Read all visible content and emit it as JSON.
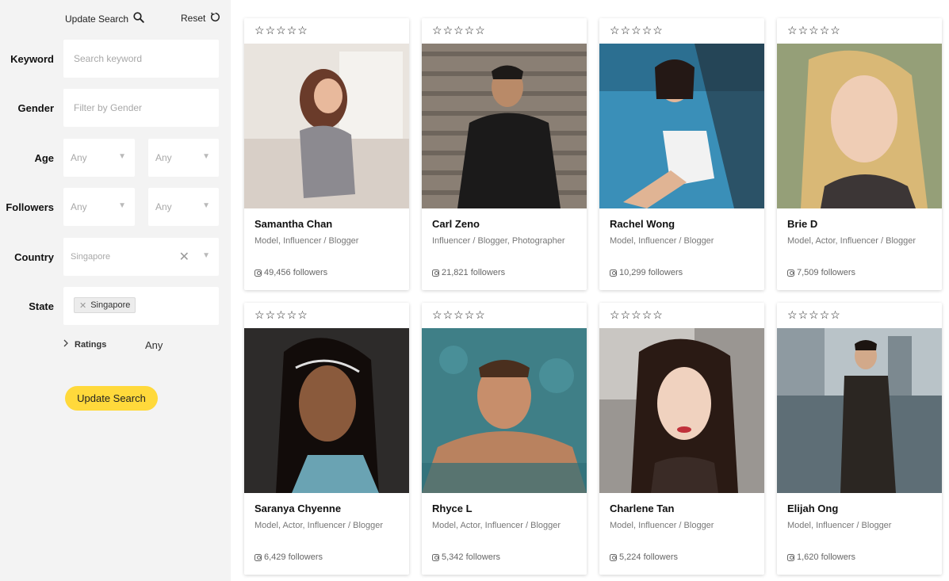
{
  "sidebar": {
    "update_search_link": "Update Search",
    "reset_link": "Reset",
    "filters": {
      "keyword": {
        "label": "Keyword",
        "placeholder": "Search keyword"
      },
      "gender": {
        "label": "Gender",
        "placeholder": "Filter by Gender"
      },
      "age": {
        "label": "Age",
        "min": "Any",
        "max": "Any"
      },
      "followers": {
        "label": "Followers",
        "min": "Any",
        "max": "Any"
      },
      "country": {
        "label": "Country",
        "value": "Singapore"
      },
      "state": {
        "label": "State",
        "tag": "Singapore"
      },
      "ratings": {
        "label": "Ratings",
        "value": "Any"
      }
    },
    "update_button": "Update Search"
  },
  "profiles": [
    {
      "name": "Samantha Chan",
      "categories": "Model, Influencer / Blogger",
      "followers": "49,456 followers"
    },
    {
      "name": "Carl Zeno",
      "categories": "Influencer / Blogger, Photographer",
      "followers": "21,821 followers"
    },
    {
      "name": "Rachel Wong",
      "categories": "Model, Influencer / Blogger",
      "followers": "10,299 followers"
    },
    {
      "name": "Brie D",
      "categories": "Model, Actor, Influencer / Blogger",
      "followers": "7,509 followers"
    },
    {
      "name": "Saranya Chyenne",
      "categories": "Model, Actor, Influencer / Blogger",
      "followers": "6,429 followers"
    },
    {
      "name": "Rhyce L",
      "categories": "Model, Actor, Influencer / Blogger",
      "followers": "5,342 followers"
    },
    {
      "name": "Charlene Tan",
      "categories": "Model, Influencer / Blogger",
      "followers": "5,224 followers"
    },
    {
      "name": "Elijah Ong",
      "categories": "Model, Influencer / Blogger",
      "followers": "1,620 followers"
    }
  ],
  "stars_glyph": "☆"
}
